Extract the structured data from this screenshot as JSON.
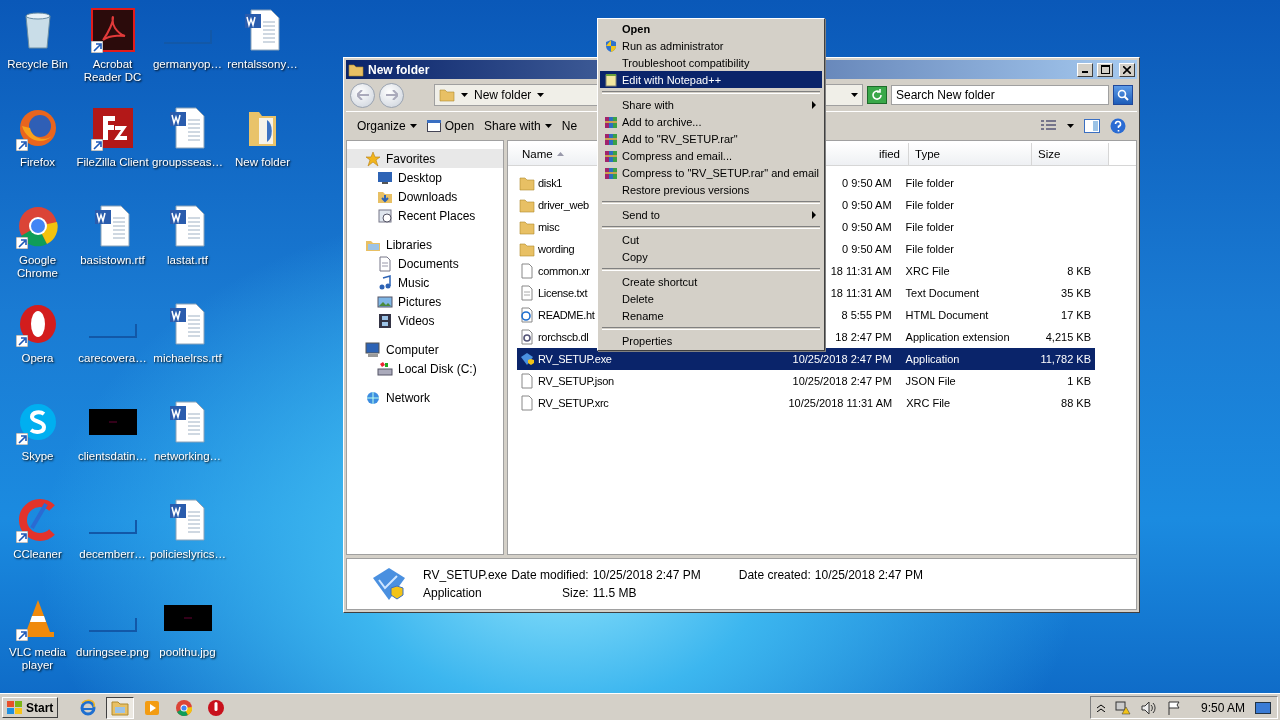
{
  "desktop_icons": [
    {
      "label": "Recycle Bin",
      "kind": "recycle-bin",
      "shortcut": false
    },
    {
      "label": "Firefox",
      "kind": "firefox",
      "shortcut": true
    },
    {
      "label": "Google Chrome",
      "kind": "chrome",
      "shortcut": true
    },
    {
      "label": "Opera",
      "kind": "opera",
      "shortcut": true
    },
    {
      "label": "Skype",
      "kind": "skype",
      "shortcut": true
    },
    {
      "label": "CCleaner",
      "kind": "ccleaner",
      "shortcut": true
    },
    {
      "label": "VLC media player",
      "kind": "vlc",
      "shortcut": true
    },
    {
      "label": "Acrobat Reader DC",
      "kind": "acrobat",
      "shortcut": true
    },
    {
      "label": "FileZilla Client",
      "kind": "filezilla",
      "shortcut": true
    },
    {
      "label": "basistown.rtf",
      "kind": "word",
      "shortcut": false
    },
    {
      "label": "carecovera…",
      "kind": "blank",
      "shortcut": false
    },
    {
      "label": "clientsdatin…",
      "kind": "dark-image",
      "shortcut": false
    },
    {
      "label": "decemberr…",
      "kind": "blank",
      "shortcut": false
    },
    {
      "label": "duringsee.png",
      "kind": "blank",
      "shortcut": false
    },
    {
      "label": "germanyop…",
      "kind": "blank",
      "shortcut": false
    },
    {
      "label": "groupsseas…",
      "kind": "word",
      "shortcut": false
    },
    {
      "label": "lastat.rtf",
      "kind": "word",
      "shortcut": false
    },
    {
      "label": "michaelrss.rtf",
      "kind": "word",
      "shortcut": false
    },
    {
      "label": "networking…",
      "kind": "word",
      "shortcut": false
    },
    {
      "label": "policieslyrics…",
      "kind": "word",
      "shortcut": false
    },
    {
      "label": "poolthu.jpg",
      "kind": "dark-image",
      "shortcut": false
    },
    {
      "label": "rentalssony…",
      "kind": "word",
      "shortcut": false
    },
    {
      "label": "New folder",
      "kind": "folder",
      "shortcut": false
    }
  ],
  "window": {
    "title": "New folder",
    "address": {
      "crumb": "New folder"
    },
    "search": {
      "placeholder": "Search New folder"
    },
    "toolbar": [
      "Organize",
      "Open",
      "Share with",
      "Ne"
    ],
    "nav_tree": [
      {
        "label": "Favorites",
        "kind": "star",
        "selected": true,
        "children": [
          {
            "label": "Desktop",
            "kind": "desktop",
            "selected": false
          },
          {
            "label": "Downloads",
            "kind": "downloads",
            "selected": false
          },
          {
            "label": "Recent Places",
            "kind": "recent",
            "selected": false
          }
        ]
      },
      {
        "label": "Libraries",
        "kind": "libraries",
        "selected": false,
        "children": [
          {
            "label": "Documents",
            "kind": "documents",
            "selected": false
          },
          {
            "label": "Music",
            "kind": "music",
            "selected": false
          },
          {
            "label": "Pictures",
            "kind": "pictures",
            "selected": false
          },
          {
            "label": "Videos",
            "kind": "videos",
            "selected": false
          }
        ]
      },
      {
        "label": "Computer",
        "kind": "computer",
        "selected": false,
        "children": [
          {
            "label": "Local Disk (C:)",
            "kind": "disk",
            "selected": false
          }
        ]
      },
      {
        "label": "Network",
        "kind": "network",
        "selected": false
      }
    ],
    "columns": [
      "Name",
      "ified",
      "Type",
      "Size"
    ],
    "rows": [
      {
        "name": "disk1",
        "kind": "folder",
        "modified": "0 9:50 AM",
        "type": "File folder",
        "size": "",
        "selected": false
      },
      {
        "name": "driver_web",
        "kind": "folder",
        "modified": "0 9:50 AM",
        "type": "File folder",
        "size": "",
        "selected": false
      },
      {
        "name": "misc",
        "kind": "folder",
        "modified": "0 9:50 AM",
        "type": "File folder",
        "size": "",
        "selected": false
      },
      {
        "name": "wording",
        "kind": "folder",
        "modified": "0 9:50 AM",
        "type": "File folder",
        "size": "",
        "selected": false
      },
      {
        "name": "common.xr",
        "kind": "file",
        "modified": "18 11:31 AM",
        "type": "XRC File",
        "size": "8 KB",
        "selected": false
      },
      {
        "name": "License.txt",
        "kind": "text",
        "modified": "18 11:31 AM",
        "type": "Text Document",
        "size": "35 KB",
        "selected": false
      },
      {
        "name": "README.ht",
        "kind": "html",
        "modified": "8 5:55 PM",
        "type": "HTML Document",
        "size": "17 KB",
        "selected": false
      },
      {
        "name": "rorchscb.dl",
        "kind": "dll",
        "modified": "18 2:47 PM",
        "type": "Application extension",
        "size": "4,215 KB",
        "selected": false
      },
      {
        "name": "RV_SETUP.exe",
        "kind": "exe",
        "modified": "10/25/2018 2:47 PM",
        "type": "Application",
        "size": "11,782 KB",
        "selected": true
      },
      {
        "name": "RV_SETUP.json",
        "kind": "file",
        "modified": "10/25/2018 2:47 PM",
        "type": "JSON File",
        "size": "1 KB",
        "selected": false
      },
      {
        "name": "RV_SETUP.xrc",
        "kind": "file",
        "modified": "10/25/2018 11:31 AM",
        "type": "XRC File",
        "size": "88 KB",
        "selected": false
      }
    ],
    "details": {
      "name": "RV_SETUP.exe",
      "type": "Application",
      "modified_label": "Date modified:",
      "modified": "10/25/2018 2:47 PM",
      "size_label": "Size:",
      "size": "11.5 MB",
      "created_label": "Date created:",
      "created": "10/25/2018 2:47 PM"
    }
  },
  "context_menu": [
    [
      {
        "label": "Open",
        "kind": "default",
        "selected": false,
        "submenu": false
      },
      {
        "label": "Run as administrator",
        "kind": "shield",
        "selected": false,
        "submenu": false
      },
      {
        "label": "Troubleshoot compatibility",
        "kind": "plain",
        "selected": false,
        "submenu": false
      },
      {
        "label": "Edit with Notepad++",
        "kind": "notepad",
        "selected": true,
        "submenu": false
      }
    ],
    [
      {
        "label": "Share with",
        "kind": "plain",
        "selected": false,
        "submenu": true
      },
      {
        "label": "Add to archive...",
        "kind": "archive",
        "selected": false,
        "submenu": false
      },
      {
        "label": "Add to \"RV_SETUP.rar\"",
        "kind": "archive",
        "selected": false,
        "submenu": false
      },
      {
        "label": "Compress and email...",
        "kind": "archive",
        "selected": false,
        "submenu": false
      },
      {
        "label": "Compress to \"RV_SETUP.rar\" and email",
        "kind": "archive",
        "selected": false,
        "submenu": false
      },
      {
        "label": "Restore previous versions",
        "kind": "plain",
        "selected": false,
        "submenu": false
      }
    ],
    [
      {
        "label": "Send to",
        "kind": "plain",
        "selected": false,
        "submenu": true
      }
    ],
    [
      {
        "label": "Cut",
        "kind": "plain",
        "selected": false,
        "submenu": false
      },
      {
        "label": "Copy",
        "kind": "plain",
        "selected": false,
        "submenu": false
      }
    ],
    [
      {
        "label": "Create shortcut",
        "kind": "plain",
        "selected": false,
        "submenu": false
      },
      {
        "label": "Delete",
        "kind": "plain",
        "selected": false,
        "submenu": false
      },
      {
        "label": "Rename",
        "kind": "plain",
        "selected": false,
        "submenu": false
      }
    ],
    [
      {
        "label": "Properties",
        "kind": "plain",
        "selected": false,
        "submenu": false
      }
    ]
  ],
  "taskbar": {
    "start": "Start",
    "apps": [
      {
        "kind": "ie",
        "selected": false
      },
      {
        "kind": "explorer",
        "selected": true
      },
      {
        "kind": "media",
        "selected": false
      },
      {
        "kind": "chrome",
        "selected": false
      },
      {
        "kind": "red-app",
        "selected": false
      }
    ],
    "clock": "9:50 AM"
  }
}
